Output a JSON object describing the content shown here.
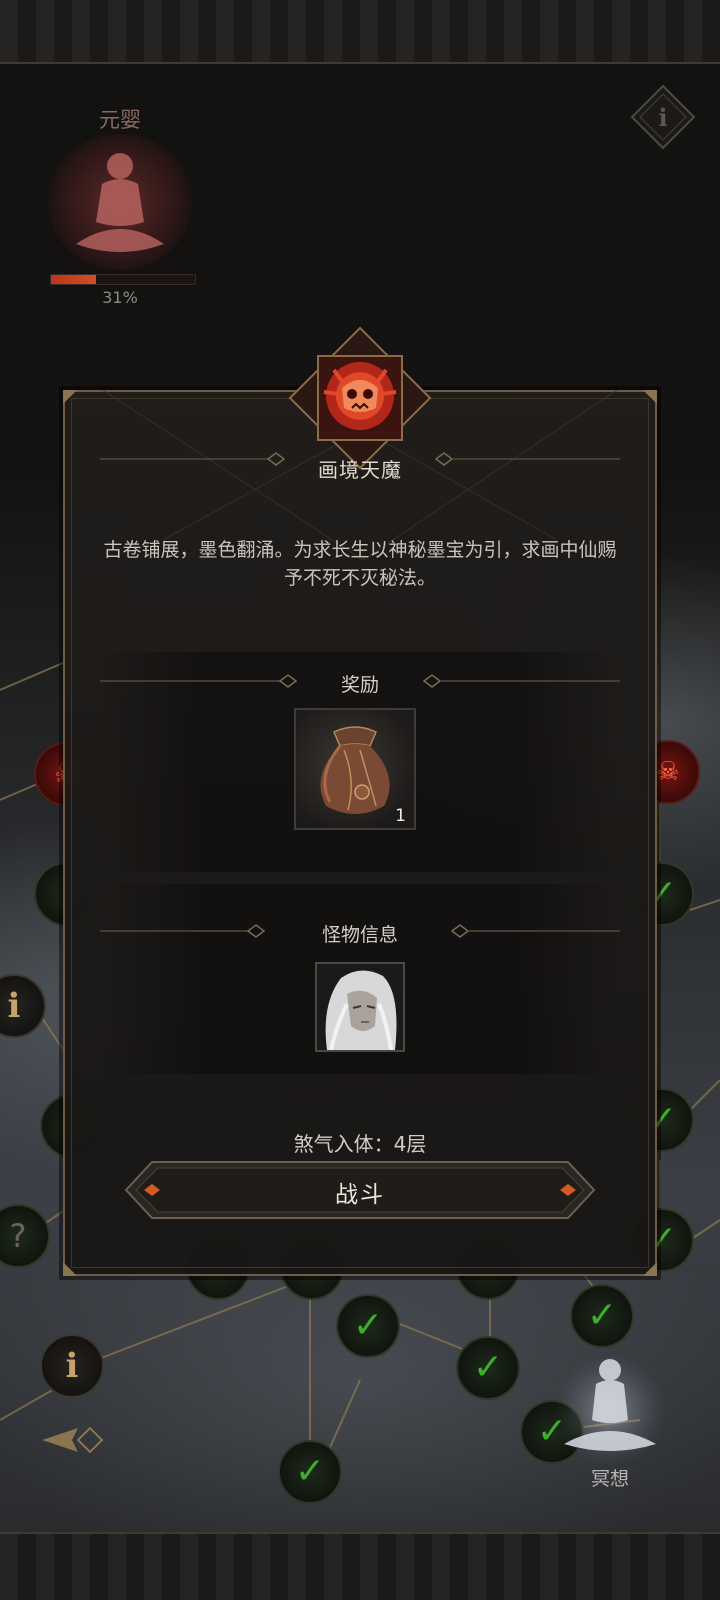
{
  "realm": {
    "title": "元婴",
    "progress_percent": 31,
    "progress_text": "31%"
  },
  "event": {
    "title": "画境天魔",
    "description": "古卷铺展，墨色翻涌。为求长生以神秘墨宝为引，求画中仙赐予不死不灭秘法。",
    "reward_label": "奖励",
    "reward_item": {
      "icon": "pouch-icon",
      "count": "1"
    },
    "monster_label": "怪物信息",
    "monster": {
      "icon": "white-haired-demon-portrait"
    },
    "status": "煞气入体：4层",
    "fight_label": "战斗"
  },
  "meditate_label": "冥想",
  "colors": {
    "accent_red": "#d54e24",
    "check_green": "#3fae2c",
    "frame_gold": "#6e5d44"
  }
}
